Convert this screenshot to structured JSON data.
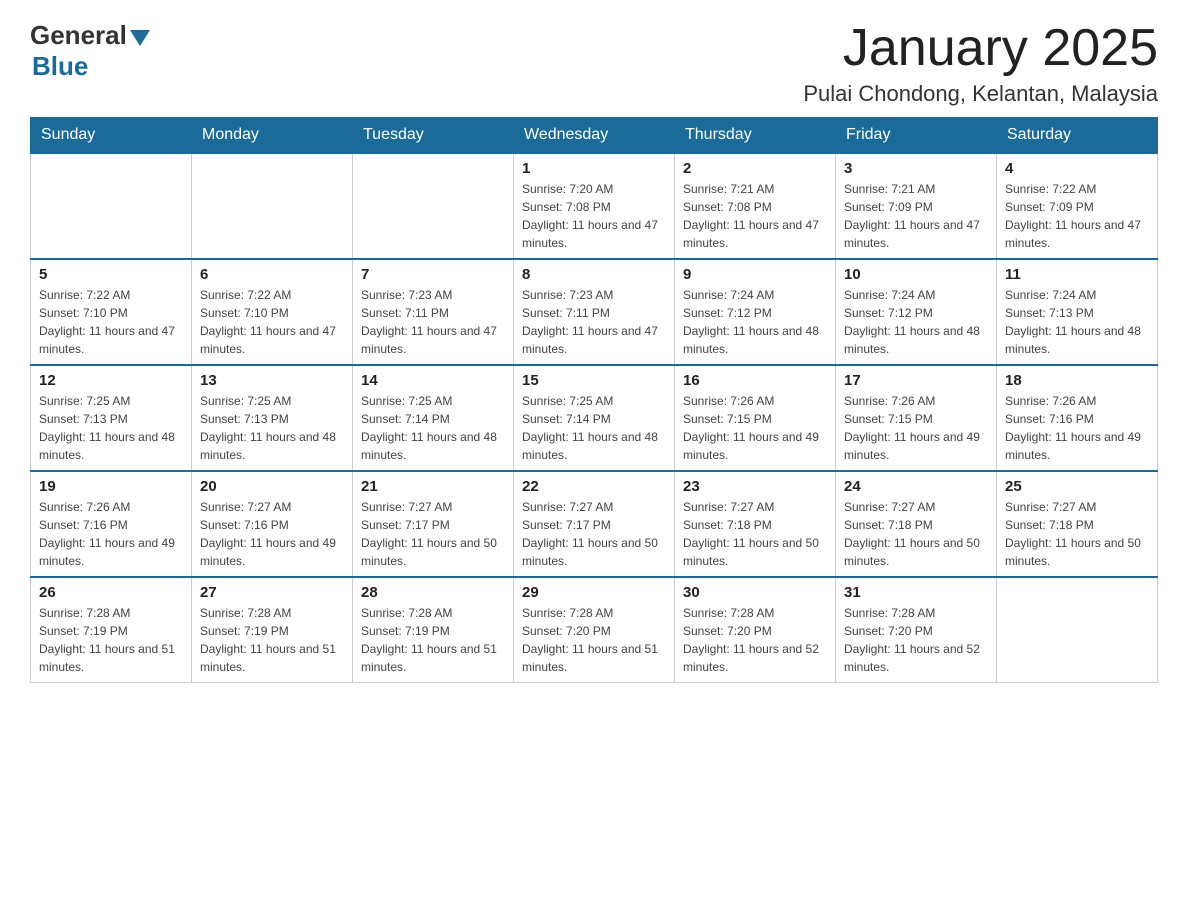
{
  "header": {
    "logo_general": "General",
    "logo_blue": "Blue",
    "month_title": "January 2025",
    "location": "Pulai Chondong, Kelantan, Malaysia"
  },
  "weekdays": [
    "Sunday",
    "Monday",
    "Tuesday",
    "Wednesday",
    "Thursday",
    "Friday",
    "Saturday"
  ],
  "weeks": [
    [
      {
        "day": "",
        "info": ""
      },
      {
        "day": "",
        "info": ""
      },
      {
        "day": "",
        "info": ""
      },
      {
        "day": "1",
        "info": "Sunrise: 7:20 AM\nSunset: 7:08 PM\nDaylight: 11 hours and 47 minutes."
      },
      {
        "day": "2",
        "info": "Sunrise: 7:21 AM\nSunset: 7:08 PM\nDaylight: 11 hours and 47 minutes."
      },
      {
        "day": "3",
        "info": "Sunrise: 7:21 AM\nSunset: 7:09 PM\nDaylight: 11 hours and 47 minutes."
      },
      {
        "day": "4",
        "info": "Sunrise: 7:22 AM\nSunset: 7:09 PM\nDaylight: 11 hours and 47 minutes."
      }
    ],
    [
      {
        "day": "5",
        "info": "Sunrise: 7:22 AM\nSunset: 7:10 PM\nDaylight: 11 hours and 47 minutes."
      },
      {
        "day": "6",
        "info": "Sunrise: 7:22 AM\nSunset: 7:10 PM\nDaylight: 11 hours and 47 minutes."
      },
      {
        "day": "7",
        "info": "Sunrise: 7:23 AM\nSunset: 7:11 PM\nDaylight: 11 hours and 47 minutes."
      },
      {
        "day": "8",
        "info": "Sunrise: 7:23 AM\nSunset: 7:11 PM\nDaylight: 11 hours and 47 minutes."
      },
      {
        "day": "9",
        "info": "Sunrise: 7:24 AM\nSunset: 7:12 PM\nDaylight: 11 hours and 48 minutes."
      },
      {
        "day": "10",
        "info": "Sunrise: 7:24 AM\nSunset: 7:12 PM\nDaylight: 11 hours and 48 minutes."
      },
      {
        "day": "11",
        "info": "Sunrise: 7:24 AM\nSunset: 7:13 PM\nDaylight: 11 hours and 48 minutes."
      }
    ],
    [
      {
        "day": "12",
        "info": "Sunrise: 7:25 AM\nSunset: 7:13 PM\nDaylight: 11 hours and 48 minutes."
      },
      {
        "day": "13",
        "info": "Sunrise: 7:25 AM\nSunset: 7:13 PM\nDaylight: 11 hours and 48 minutes."
      },
      {
        "day": "14",
        "info": "Sunrise: 7:25 AM\nSunset: 7:14 PM\nDaylight: 11 hours and 48 minutes."
      },
      {
        "day": "15",
        "info": "Sunrise: 7:25 AM\nSunset: 7:14 PM\nDaylight: 11 hours and 48 minutes."
      },
      {
        "day": "16",
        "info": "Sunrise: 7:26 AM\nSunset: 7:15 PM\nDaylight: 11 hours and 49 minutes."
      },
      {
        "day": "17",
        "info": "Sunrise: 7:26 AM\nSunset: 7:15 PM\nDaylight: 11 hours and 49 minutes."
      },
      {
        "day": "18",
        "info": "Sunrise: 7:26 AM\nSunset: 7:16 PM\nDaylight: 11 hours and 49 minutes."
      }
    ],
    [
      {
        "day": "19",
        "info": "Sunrise: 7:26 AM\nSunset: 7:16 PM\nDaylight: 11 hours and 49 minutes."
      },
      {
        "day": "20",
        "info": "Sunrise: 7:27 AM\nSunset: 7:16 PM\nDaylight: 11 hours and 49 minutes."
      },
      {
        "day": "21",
        "info": "Sunrise: 7:27 AM\nSunset: 7:17 PM\nDaylight: 11 hours and 50 minutes."
      },
      {
        "day": "22",
        "info": "Sunrise: 7:27 AM\nSunset: 7:17 PM\nDaylight: 11 hours and 50 minutes."
      },
      {
        "day": "23",
        "info": "Sunrise: 7:27 AM\nSunset: 7:18 PM\nDaylight: 11 hours and 50 minutes."
      },
      {
        "day": "24",
        "info": "Sunrise: 7:27 AM\nSunset: 7:18 PM\nDaylight: 11 hours and 50 minutes."
      },
      {
        "day": "25",
        "info": "Sunrise: 7:27 AM\nSunset: 7:18 PM\nDaylight: 11 hours and 50 minutes."
      }
    ],
    [
      {
        "day": "26",
        "info": "Sunrise: 7:28 AM\nSunset: 7:19 PM\nDaylight: 11 hours and 51 minutes."
      },
      {
        "day": "27",
        "info": "Sunrise: 7:28 AM\nSunset: 7:19 PM\nDaylight: 11 hours and 51 minutes."
      },
      {
        "day": "28",
        "info": "Sunrise: 7:28 AM\nSunset: 7:19 PM\nDaylight: 11 hours and 51 minutes."
      },
      {
        "day": "29",
        "info": "Sunrise: 7:28 AM\nSunset: 7:20 PM\nDaylight: 11 hours and 51 minutes."
      },
      {
        "day": "30",
        "info": "Sunrise: 7:28 AM\nSunset: 7:20 PM\nDaylight: 11 hours and 52 minutes."
      },
      {
        "day": "31",
        "info": "Sunrise: 7:28 AM\nSunset: 7:20 PM\nDaylight: 11 hours and 52 minutes."
      },
      {
        "day": "",
        "info": ""
      }
    ]
  ]
}
